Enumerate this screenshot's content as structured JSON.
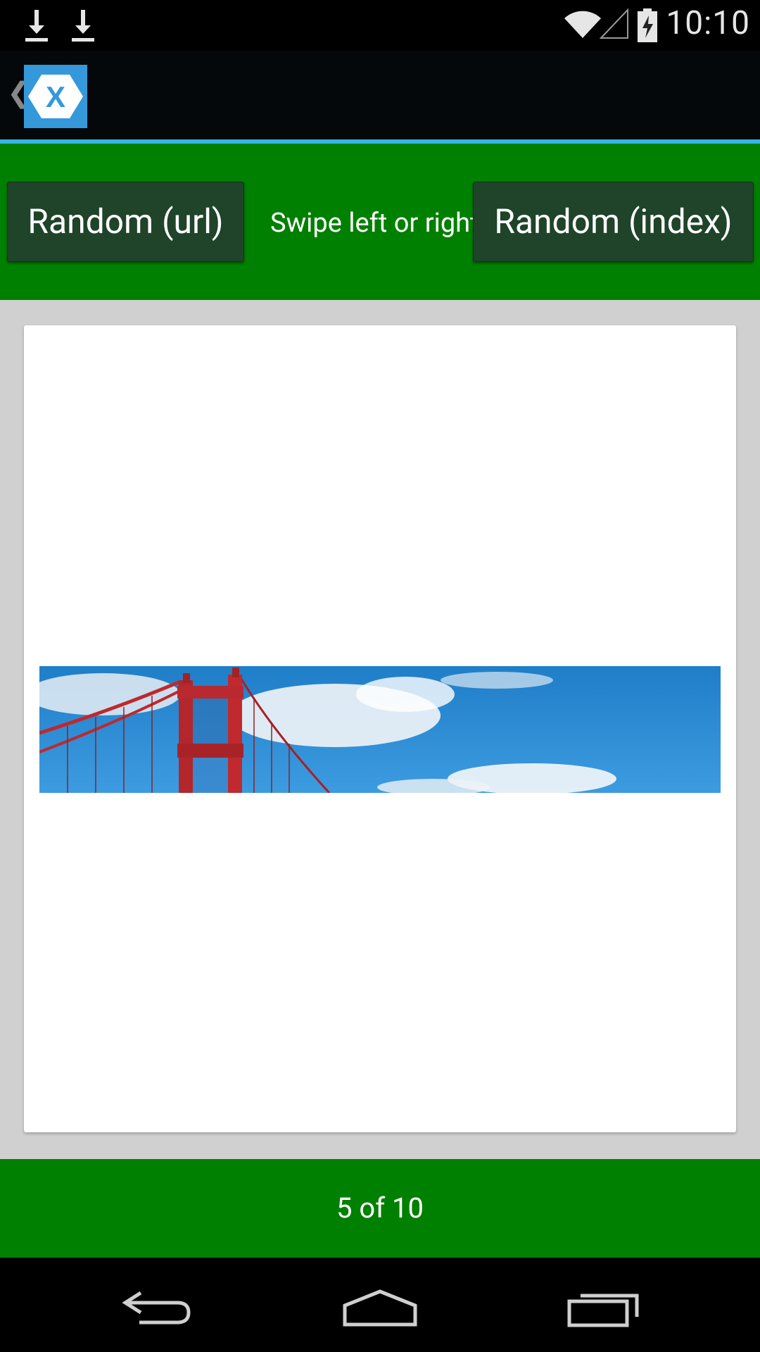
{
  "status_bar": {
    "time": "10:10",
    "icons": [
      "download-icon",
      "download-icon",
      "wifi-icon",
      "signal-icon",
      "battery-charging-icon"
    ]
  },
  "action_bar": {
    "up_icon": "chevron-left-icon",
    "app_icon": "xamarin-logo-icon",
    "accent_color": "#33b5e5"
  },
  "controls": {
    "random_url_label": "Random (url)",
    "swipe_hint": "Swipe left or right",
    "random_index_label": "Random (index)",
    "bar_color": "#008000",
    "button_color": "#1f4429"
  },
  "gallery": {
    "image_icon": "golden-gate-bridge-photo"
  },
  "footer": {
    "page_indicator": "5 of 10"
  },
  "nav_bar": {
    "icons": [
      "back-icon",
      "home-icon",
      "recent-apps-icon"
    ]
  }
}
